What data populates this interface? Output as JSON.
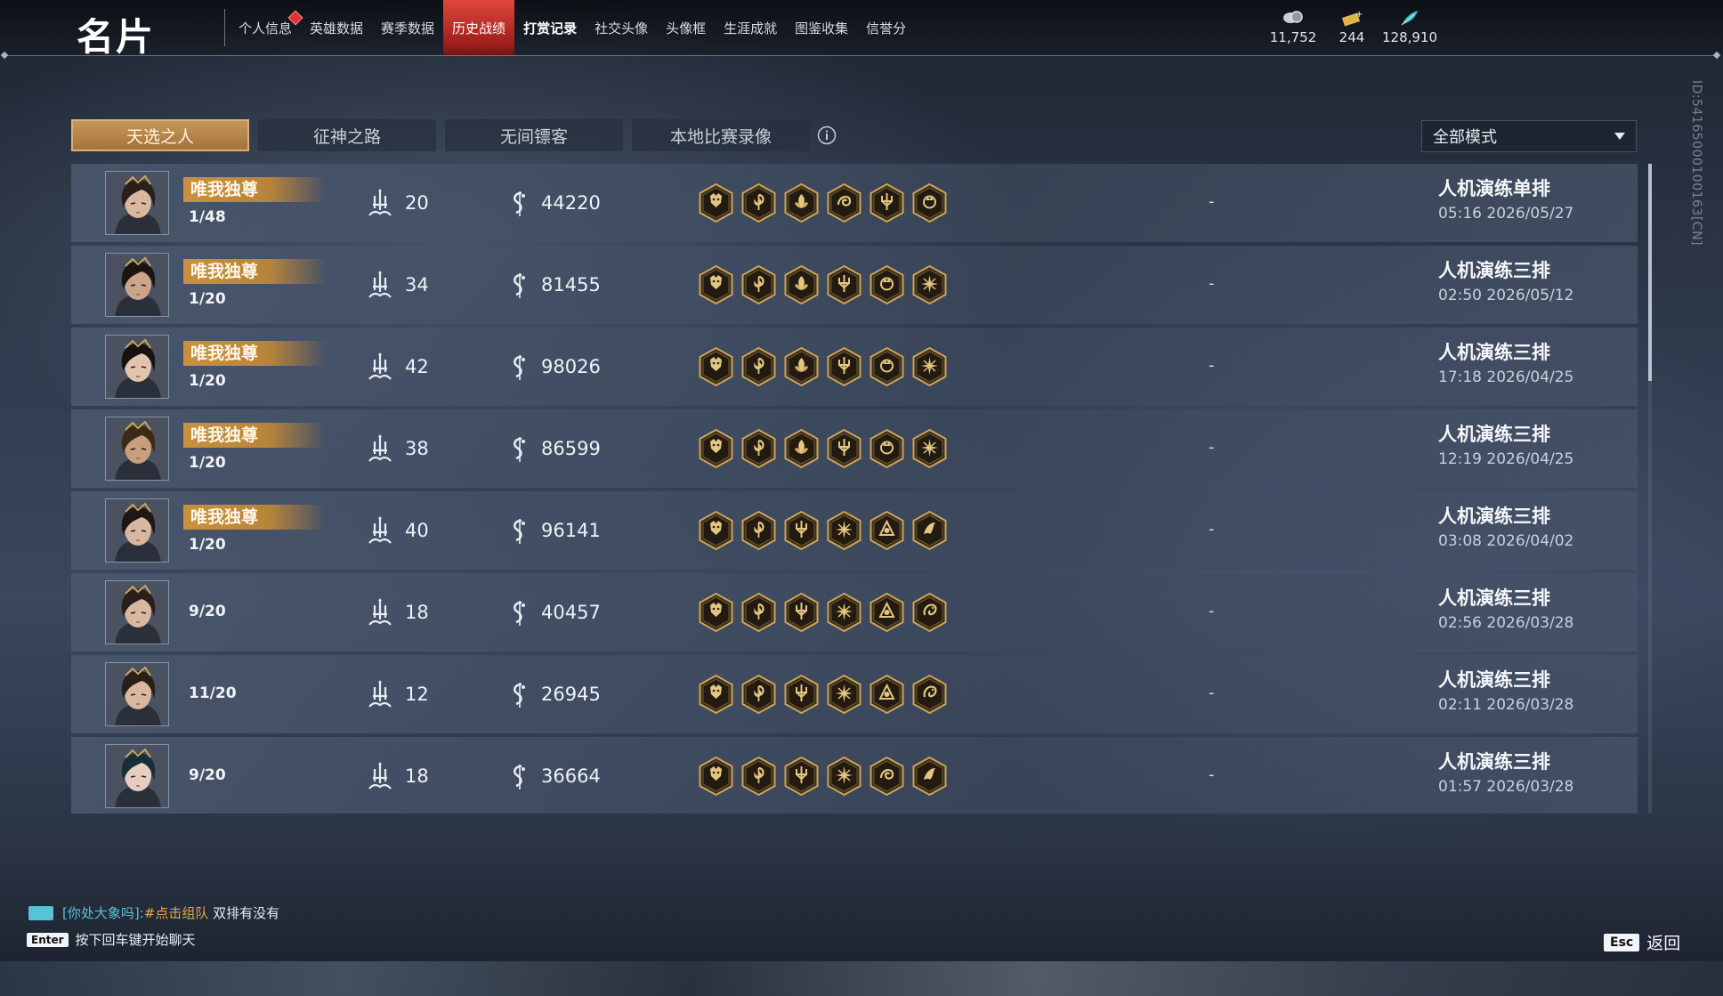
{
  "header": {
    "title": "名片",
    "nav": [
      {
        "label": "个人信息",
        "active": false,
        "notify": true
      },
      {
        "label": "英雄数据",
        "active": false
      },
      {
        "label": "赛季数据",
        "active": false
      },
      {
        "label": "历史战绩",
        "active": true
      },
      {
        "label": "打赏记录",
        "active": false,
        "bold": true
      },
      {
        "label": "社交头像",
        "active": false
      },
      {
        "label": "头像框",
        "active": false
      },
      {
        "label": "生涯成就",
        "active": false
      },
      {
        "label": "图鉴收集",
        "active": false
      },
      {
        "label": "信誉分",
        "active": false
      }
    ],
    "currencies": [
      {
        "icon": "coin-icon",
        "value": "11,752"
      },
      {
        "icon": "ticket-icon",
        "value": "244"
      },
      {
        "icon": "feather-icon",
        "value": "128,910"
      }
    ]
  },
  "side_id": "ID:54165000100163[CN]",
  "tabs": [
    {
      "label": "天选之人",
      "active": true
    },
    {
      "label": "征神之路",
      "active": false
    },
    {
      "label": "无间镖客",
      "active": false
    },
    {
      "label": "本地比赛录像",
      "active": false
    }
  ],
  "mode_filter": {
    "selected": "全部模式"
  },
  "matches": [
    {
      "badge": "唯我独尊",
      "rank": "1/48",
      "kills": "20",
      "score": "44220",
      "dash": "-",
      "mode": "人机演练单排",
      "time": "05:16  2026/05/27",
      "hair": "#2a1f1a",
      "skin": "#d8b9a0",
      "equip": [
        "demon-mask",
        "spiral",
        "lotus",
        "swirl",
        "trident",
        "crown"
      ]
    },
    {
      "badge": "唯我独尊",
      "rank": "1/20",
      "kills": "34",
      "score": "81455",
      "dash": "-",
      "mode": "人机演练三排",
      "time": "02:50  2026/05/12",
      "hair": "#1b1512",
      "skin": "#caa58a",
      "equip": [
        "demon-mask",
        "spiral",
        "lotus",
        "trident",
        "crown",
        "star"
      ]
    },
    {
      "badge": "唯我独尊",
      "rank": "1/20",
      "kills": "42",
      "score": "98026",
      "dash": "-",
      "mode": "人机演练三排",
      "time": "17:18  2026/04/25",
      "hair": "#17120f",
      "skin": "#e2c4ae",
      "equip": [
        "demon-mask",
        "spiral",
        "lotus",
        "trident",
        "crown",
        "star"
      ]
    },
    {
      "badge": "唯我独尊",
      "rank": "1/20",
      "kills": "38",
      "score": "86599",
      "dash": "-",
      "mode": "人机演练三排",
      "time": "12:19  2026/04/25",
      "hair": "#3a2a18",
      "skin": "#c79e7e",
      "equip": [
        "demon-mask",
        "spiral",
        "lotus",
        "trident",
        "crown",
        "star"
      ]
    },
    {
      "badge": "唯我独尊",
      "rank": "1/20",
      "kills": "40",
      "score": "96141",
      "dash": "-",
      "mode": "人机演练三排",
      "time": "03:08  2026/04/02",
      "hair": "#1e1714",
      "skin": "#d6b8a2",
      "equip": [
        "demon-mask",
        "spiral",
        "trident",
        "star",
        "triangle",
        "phoenix"
      ]
    },
    {
      "badge": "",
      "rank": "9/20",
      "kills": "18",
      "score": "40457",
      "dash": "-",
      "mode": "人机演练三排",
      "time": "02:56  2026/03/28",
      "hair": "#2a1f1a",
      "skin": "#d8b9a0",
      "equip": [
        "demon-mask",
        "spiral",
        "trident",
        "star",
        "triangle",
        "dragon"
      ]
    },
    {
      "badge": "",
      "rank": "11/20",
      "kills": "12",
      "score": "26945",
      "dash": "-",
      "mode": "人机演练三排",
      "time": "02:11  2026/03/28",
      "hair": "#2a1f1a",
      "skin": "#d8b9a0",
      "equip": [
        "demon-mask",
        "spiral",
        "trident",
        "star",
        "triangle",
        "dragon"
      ]
    },
    {
      "badge": "",
      "rank": "9/20",
      "kills": "18",
      "score": "36664",
      "dash": "-",
      "mode": "人机演练三排",
      "time": "01:57  2026/03/28",
      "hair": "#16303a",
      "skin": "#e6cfc2",
      "equip": [
        "demon-mask",
        "spiral",
        "trident",
        "star",
        "swirl",
        "phoenix"
      ]
    }
  ],
  "chat": {
    "channel": "[你处大象吗]:",
    "link": "#点击组队",
    "message": " 双排有没有",
    "enter_key": "Enter",
    "enter_hint": "按下回车键开始聊天"
  },
  "footer": {
    "esc_key": "Esc",
    "back_label": "返回"
  },
  "colors": {
    "accent_red": "#c8322b",
    "badge_gold": "#c9913d",
    "tab_active": "#b9864a",
    "chat_channel": "#58c2d6",
    "chat_link": "#e2a84a"
  }
}
